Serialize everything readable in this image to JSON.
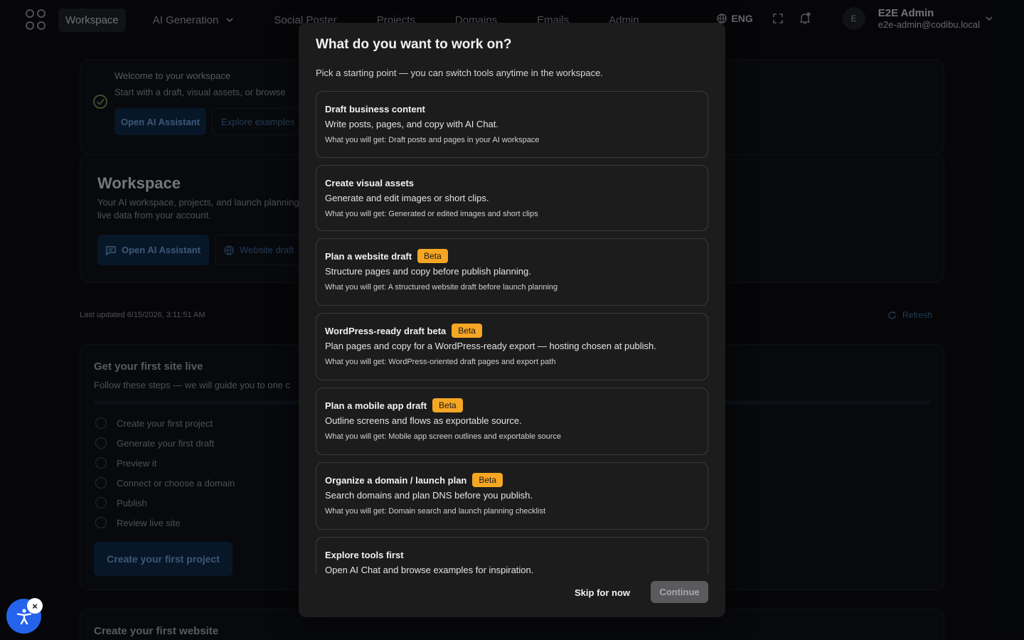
{
  "nav": {
    "items": [
      {
        "label": "Workspace",
        "active": true
      },
      {
        "label": "AI Generation",
        "active": false
      },
      {
        "label": "Social Poster",
        "active": false
      },
      {
        "label": "Projects",
        "active": false
      },
      {
        "label": "Domains",
        "active": false
      },
      {
        "label": "Emails",
        "active": false
      },
      {
        "label": "Admin",
        "active": false
      }
    ],
    "language": "ENG",
    "user": {
      "initial": "E",
      "name": "E2E Admin",
      "email": "e2e-admin@codibu.local"
    }
  },
  "welcome_banner": {
    "title": "Welcome to your workspace",
    "subtitle": "Start with a draft, visual assets, or browse",
    "primary_label": "Open AI Assistant",
    "secondary_label": "Explore examples"
  },
  "workspace_header": {
    "title": "Workspace",
    "subtitle_line1": "Your AI workspace, projects, and launch planning",
    "subtitle_line2": "live data from your account.",
    "primary_label": "Open AI Assistant",
    "secondary_label": "Website draft"
  },
  "status": {
    "last_updated": "Last updated 6/15/2026, 3:11:51 AM",
    "refresh_label": "Refresh"
  },
  "first_site": {
    "title": "Get your first site live",
    "subtitle": "Follow these steps — we will guide you to one c",
    "steps": [
      "Create your first project",
      "Generate your first draft",
      "Preview it",
      "Connect or choose a domain",
      "Publish",
      "Review live site"
    ],
    "cta_label": "Create your first project"
  },
  "first_website": {
    "title": "Create your first website"
  },
  "modal": {
    "title": "What do you want to work on?",
    "subtitle": "Pick a starting point — you can switch tools anytime in the workspace.",
    "options": [
      {
        "title": "Draft business content",
        "badge": "",
        "description": "Write posts, pages, and copy with AI Chat.",
        "get": "What you will get: Draft posts and pages in your AI workspace"
      },
      {
        "title": "Create visual assets",
        "badge": "",
        "description": "Generate and edit images or short clips.",
        "get": "What you will get: Generated or edited images and short clips"
      },
      {
        "title": "Plan a website draft",
        "badge": "Beta",
        "description": "Structure pages and copy before publish planning.",
        "get": "What you will get: A structured website draft before launch planning"
      },
      {
        "title": "WordPress-ready draft beta",
        "badge": "Beta",
        "description": "Plan pages and copy for a WordPress-ready export — hosting chosen at publish.",
        "get": "What you will get: WordPress-oriented draft pages and export path"
      },
      {
        "title": "Plan a mobile app draft",
        "badge": "Beta",
        "description": "Outline screens and flows as exportable source.",
        "get": "What you will get: Mobile app screen outlines and exportable source"
      },
      {
        "title": "Organize a domain / launch plan",
        "badge": "Beta",
        "description": "Search domains and plan DNS before you publish.",
        "get": "What you will get: Domain search and launch planning checklist"
      },
      {
        "title": "Explore tools first",
        "badge": "",
        "description": "Open AI Chat and browse examples for inspiration.",
        "get": ""
      }
    ],
    "skip_label": "Skip for now",
    "continue_label": "Continue"
  },
  "accessibility": {
    "close_label": "×"
  }
}
